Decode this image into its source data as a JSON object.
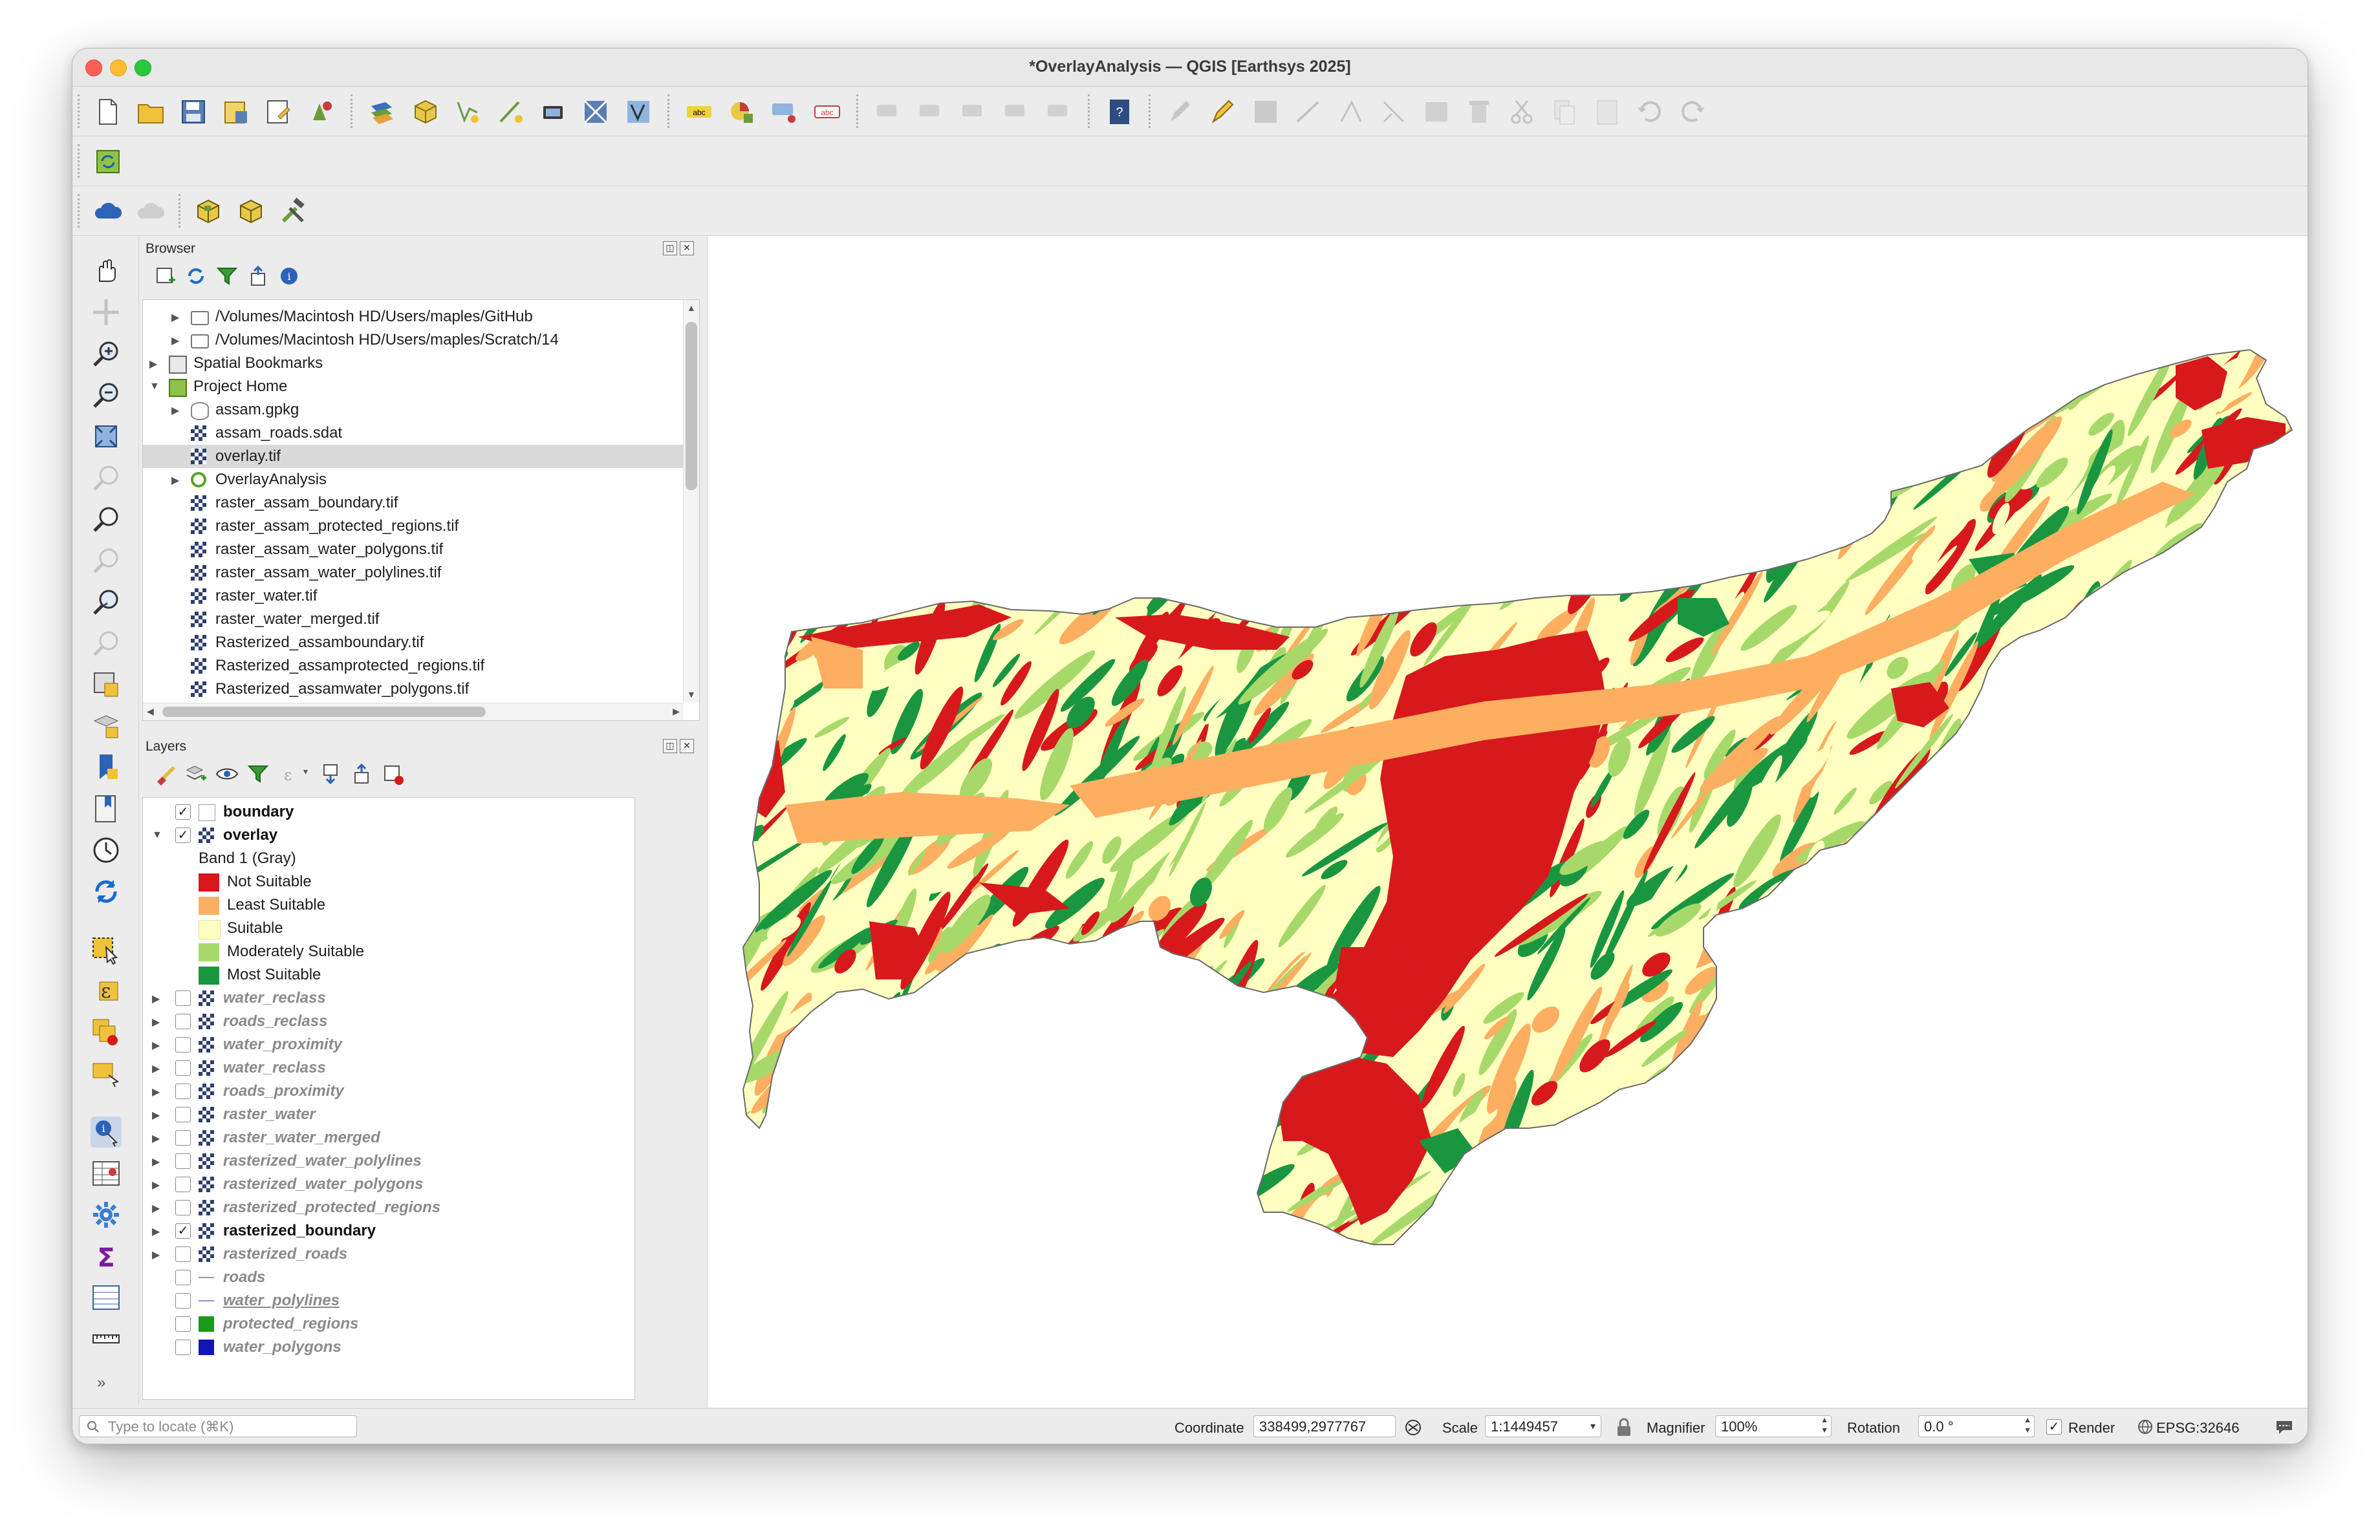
{
  "window": {
    "title": "*OverlayAnalysis — QGIS [Earthsys 2025]"
  },
  "toolbar_icons": [
    "new-project-icon",
    "open-project-icon",
    "save-project-icon",
    "save-as-icon",
    "print-layout-icon",
    "style-manager-icon",
    "data-source-manager-icon",
    "new-geopackage-icon",
    "new-shapefile-icon",
    "new-memory-layer-icon",
    "new-virtual-layer-icon",
    "new-temporary-layer-icon",
    "label-toolbar-icon",
    "layer-diagram-icon",
    "pin-labels-icon",
    "highlight-labels-icon",
    "help-icon",
    "edit-pencil-icon",
    "toggle-editing-icon",
    "save-edits-icon",
    "digitize-icon",
    "vertex-tool-icon",
    "delete-icon",
    "cut-icon",
    "copy-icon",
    "paste-icon",
    "undo-icon",
    "redo-icon"
  ],
  "browser": {
    "title": "Browser",
    "items": [
      {
        "label": "/Volumes/Macintosh HD/Users/maples/GitHub",
        "icon": "folder-icon"
      },
      {
        "label": "/Volumes/Macintosh HD/Users/maples/Scratch/14",
        "icon": "folder-icon"
      },
      {
        "label": "Spatial Bookmarks",
        "icon": "bookmark-icon"
      },
      {
        "label": "Project Home",
        "icon": "project-home-icon"
      },
      {
        "label": "assam.gpkg",
        "icon": "geopackage-icon"
      },
      {
        "label": "assam_roads.sdat",
        "icon": "raster-icon"
      },
      {
        "label": "overlay.tif",
        "icon": "raster-icon"
      },
      {
        "label": "OverlayAnalysis",
        "icon": "qgis-project-icon"
      },
      {
        "label": "raster_assam_boundary.tif",
        "icon": "raster-icon"
      },
      {
        "label": "raster_assam_protected_regions.tif",
        "icon": "raster-icon"
      },
      {
        "label": "raster_assam_water_polygons.tif",
        "icon": "raster-icon"
      },
      {
        "label": "raster_assam_water_polylines.tif",
        "icon": "raster-icon"
      },
      {
        "label": "raster_water.tif",
        "icon": "raster-icon"
      },
      {
        "label": "raster_water_merged.tif",
        "icon": "raster-icon"
      },
      {
        "label": "Rasterized_assamboundary.tif",
        "icon": "raster-icon"
      },
      {
        "label": "Rasterized_assamprotected_regions.tif",
        "icon": "raster-icon"
      },
      {
        "label": "Rasterized_assamwater_polygons.tif",
        "icon": "raster-icon"
      },
      {
        "label": "Rasterized_assamwater_polylines.tif",
        "icon": "raster-icon"
      }
    ]
  },
  "layers": {
    "title": "Layers",
    "band_label": "Band 1 (Gray)",
    "boundary": "boundary",
    "overlay": "overlay",
    "legend": [
      {
        "label": "Not Suitable",
        "color": "#d7191c"
      },
      {
        "label": "Least Suitable",
        "color": "#fdae61"
      },
      {
        "label": "Suitable",
        "color": "#ffffc0"
      },
      {
        "label": "Moderately Suitable",
        "color": "#a6d96a"
      },
      {
        "label": "Most Suitable",
        "color": "#1a9641"
      }
    ],
    "items": [
      {
        "label": "water_reclass",
        "checked": false
      },
      {
        "label": "roads_reclass",
        "checked": false
      },
      {
        "label": "water_proximity",
        "checked": false
      },
      {
        "label": "water_reclass",
        "checked": false
      },
      {
        "label": "roads_proximity",
        "checked": false
      },
      {
        "label": "raster_water",
        "checked": false
      },
      {
        "label": "raster_water_merged",
        "checked": false
      },
      {
        "label": "rasterized_water_polylines",
        "checked": false
      },
      {
        "label": "rasterized_water_polygons",
        "checked": false
      },
      {
        "label": "rasterized_protected_regions",
        "checked": false
      },
      {
        "label": "rasterized_boundary",
        "checked": true
      },
      {
        "label": "rasterized_roads",
        "checked": false
      },
      {
        "label": "roads",
        "checked": false
      },
      {
        "label": "water_polylines",
        "checked": false
      },
      {
        "label": "protected_regions",
        "checked": false
      },
      {
        "label": "water_polygons",
        "checked": false
      }
    ],
    "protected_color": "#1a9a1a",
    "water_polygons_color": "#1414b4"
  },
  "status": {
    "locate_placeholder": "Type to locate (⌘K)",
    "coordinate_label": "Coordinate",
    "coordinate_value": "338499,2977767",
    "scale_label": "Scale",
    "scale_value": "1:1449457",
    "magnifier_label": "Magnifier",
    "magnifier_value": "100%",
    "rotation_label": "Rotation",
    "rotation_value": "0.0 °",
    "render_label": "Render",
    "crs": "EPSG:32646"
  },
  "map": {
    "palette": {
      "not": "#d7191c",
      "least": "#fdae61",
      "suit": "#ffffc0",
      "mod": "#a6d96a",
      "most": "#1a9641"
    }
  }
}
